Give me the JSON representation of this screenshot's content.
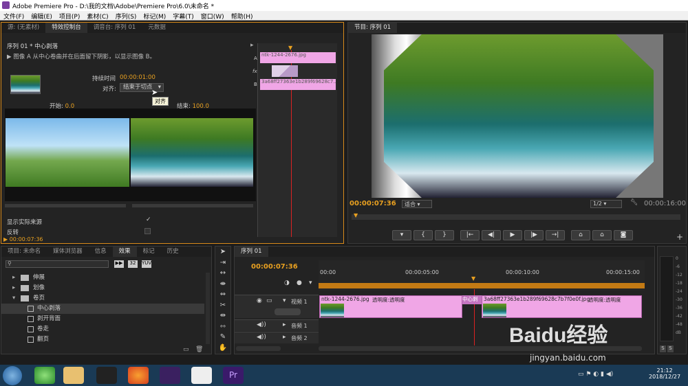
{
  "window": {
    "title": "Adobe Premiere Pro - D:\\我的文档\\Adobe\\Premiere Pro\\6.0\\未命名 *"
  },
  "menu": [
    "文件(F)",
    "编辑(E)",
    "项目(P)",
    "素材(C)",
    "序列(S)",
    "标记(M)",
    "字幕(T)",
    "窗口(W)",
    "帮助(H)"
  ],
  "effect_controls": {
    "tabs": [
      "源: (无素材)",
      "特效控制台",
      "调音台: 序列 01",
      "元数据"
    ],
    "sequence_title": "序列 01 * 中心剥落",
    "description": "图像 A 从中心卷曲并在后面留下阴影，以显示图像 B。",
    "duration_label": "持续时间",
    "duration_value": "00:00:01:00",
    "align_label": "对齐:",
    "align_value": "结束于切点",
    "tooltip": "对齐",
    "start_label": "开始:",
    "start_value": "0.0",
    "end_label": "结束:",
    "end_value": "100.0",
    "show_actual_sources": "显示实际来源",
    "reverse": "反转",
    "clip_a": "ntk-1244-2676.jpg",
    "clip_b": "3a68ff27363e1b289f69628c7...",
    "track_a": "A",
    "track_b": "B",
    "timecode": "00:00:07:36"
  },
  "program": {
    "tab": "节目: 序列 01",
    "timecode": "00:00:07:36",
    "fit": "适合",
    "resolution": "1/2",
    "duration": "00:00:16:00"
  },
  "project": {
    "tabs": [
      "项目: 未命名",
      "媒体浏览器",
      "信息",
      "效果",
      "标记",
      "历史"
    ],
    "items": [
      {
        "label": "伸展",
        "type": "folder"
      },
      {
        "label": "划像",
        "type": "folder"
      },
      {
        "label": "卷页",
        "type": "folder-open"
      },
      {
        "label": "中心剥落",
        "type": "effect"
      },
      {
        "label": "剥开背面",
        "type": "effect"
      },
      {
        "label": "卷走",
        "type": "effect"
      },
      {
        "label": "翻页",
        "type": "effect"
      }
    ]
  },
  "timeline": {
    "tab": "序列 01",
    "timecode": "00:00:07:36",
    "ruler": [
      "00:00",
      "00:00:05:00",
      "00:00:10:00",
      "00:00:15:00"
    ],
    "video_track": "视频 1",
    "audio_tracks": [
      "音频 1",
      "音频 2"
    ],
    "clip1_label": "ntk-1244-2676.jpg",
    "clip1_fx": "透明度:透明度",
    "transition_label": "中心剥",
    "clip2_label": "3a68ff27363e1b289f69628c7b7f0e0f.jpg",
    "clip2_fx": "透明度:透明度"
  },
  "audio_meter": {
    "labels": [
      "0",
      "-6",
      "-12",
      "-18",
      "-24",
      "-30",
      "-36",
      "-42",
      "-48",
      "dB"
    ],
    "solo": [
      "S",
      "S"
    ]
  },
  "taskbar": {
    "time": "21:12",
    "date": "2018/12/27"
  },
  "watermark": {
    "brand": "Baidu经验",
    "url": "jingyan.baidu.com"
  }
}
